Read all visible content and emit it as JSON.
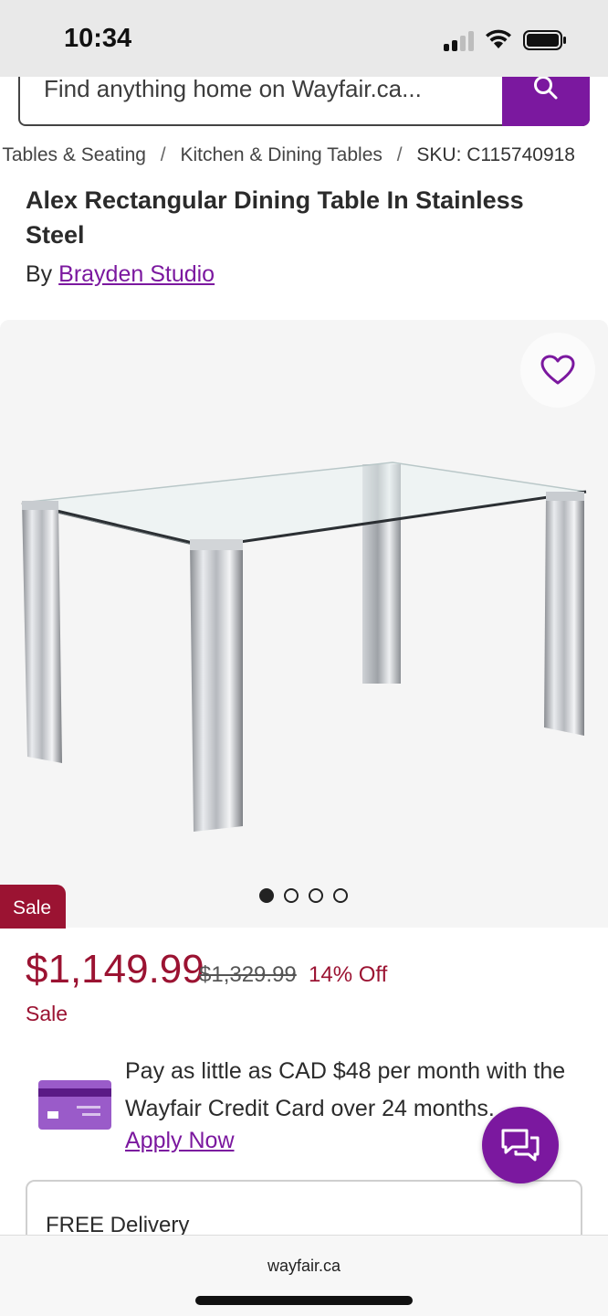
{
  "status_bar": {
    "time": "10:34"
  },
  "search": {
    "placeholder": "Find anything home on Wayfair.ca..."
  },
  "breadcrumb": {
    "items": [
      "Tables & Seating",
      "Kitchen & Dining Tables"
    ],
    "sku": "SKU: C115740918"
  },
  "product": {
    "title": "Alex Rectangular Dining Table In Stainless Steel",
    "by_label": "By",
    "brand": "Brayden Studio"
  },
  "gallery": {
    "sale_tag": "Sale",
    "image_count": 4,
    "active_image": 1
  },
  "pricing": {
    "price": "$1,149.99",
    "original_price": "$1,329.99",
    "discount": "14% Off",
    "sale_label": "Sale"
  },
  "financing": {
    "text": "Pay as little as CAD $48 per month with the Wayfair Credit Card over 24 months.",
    "link": "Apply Now"
  },
  "delivery": {
    "label": "FREE Delivery"
  },
  "browser": {
    "url": "wayfair.ca"
  },
  "colors": {
    "brand": "#7b189f",
    "sale": "#9b1332"
  },
  "icons": [
    "signal-icon",
    "wifi-icon",
    "battery-icon",
    "search-icon",
    "heart-icon",
    "credit-card-icon",
    "chat-icon"
  ]
}
